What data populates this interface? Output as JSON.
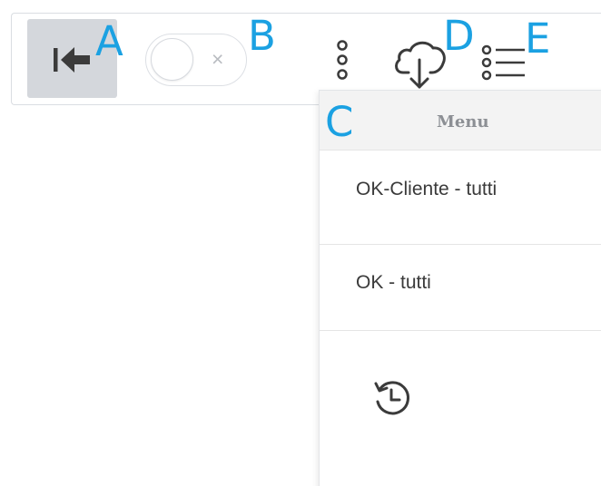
{
  "toolbar": {
    "collapse_button_icon": "collapse-left-arrow-icon",
    "toggle_state": "off",
    "toggle_icon": "close-x-icon",
    "toggle_glyph": "×",
    "kebab_icon": "three-dots-vertical-icon",
    "download_icon": "cloud-download-icon",
    "list_icon": "bulleted-list-icon"
  },
  "callouts": {
    "a": "A",
    "b": "B",
    "c": "C",
    "d": "D",
    "e": "E",
    "color": "#1ba1e2"
  },
  "menu": {
    "header": "Menu",
    "items": [
      {
        "label": "OK-Cliente - tutti"
      },
      {
        "label": "OK - tutti"
      }
    ],
    "history_icon": "history-clock-icon"
  },
  "colors": {
    "active_button_bg": "#d4d7dc",
    "icon_color": "#3b3b3b",
    "menu_header_bg": "#f3f3f3",
    "menu_header_text": "#8c8f94",
    "border": "#dadde2"
  }
}
